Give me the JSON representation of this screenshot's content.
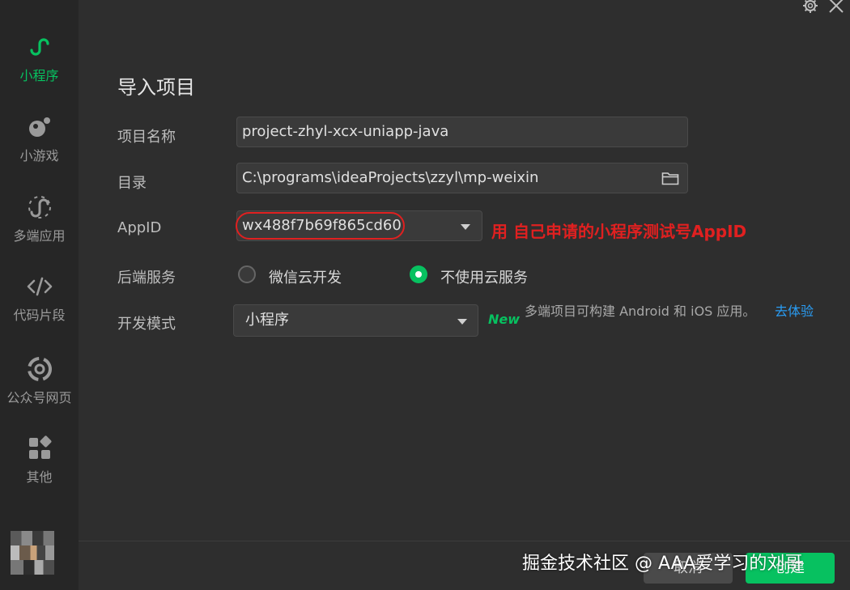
{
  "sidebar": {
    "items": [
      {
        "label": "小程序",
        "icon": "mini-program-icon",
        "active": true
      },
      {
        "label": "小游戏",
        "icon": "mini-game-icon",
        "active": false
      },
      {
        "label": "多端应用",
        "icon": "multi-platform-icon",
        "active": false
      },
      {
        "label": "代码片段",
        "icon": "code-snippet-icon",
        "active": false
      },
      {
        "label": "公众号网页",
        "icon": "official-account-icon",
        "active": false
      },
      {
        "label": "其他",
        "icon": "other-grid-icon",
        "active": false
      }
    ]
  },
  "dialog": {
    "title": "导入项目",
    "project_name": {
      "label": "项目名称",
      "value": "project-zhyl-xcx-uniapp-java"
    },
    "directory": {
      "label": "目录",
      "value": "C:\\programs\\ideaProjects\\zzyl\\mp-weixin"
    },
    "appid": {
      "label": "AppID",
      "value": "wx488f7b69f865cd60"
    },
    "annotation": "用 自己申请的小程序测试号AppID",
    "backend": {
      "label": "后端服务",
      "options": [
        {
          "label": "微信云开发",
          "selected": false
        },
        {
          "label": "不使用云服务",
          "selected": true
        }
      ]
    },
    "dev_mode": {
      "label": "开发模式",
      "value": "小程序",
      "new_badge": "New",
      "hint": "多端项目可构建 Android 和 iOS 应用。",
      "try_link": "去体验"
    }
  },
  "footer": {
    "cancel_label": "取消",
    "create_label": "创建"
  },
  "watermark": "掘金技术社区 @ AAA爱学习的刘哥",
  "colors": {
    "accent": "#07c160",
    "annotation_red": "#e02020",
    "link_blue": "#2a9df4",
    "background": "#2e2e2e",
    "sidebar_bg": "#262626"
  }
}
